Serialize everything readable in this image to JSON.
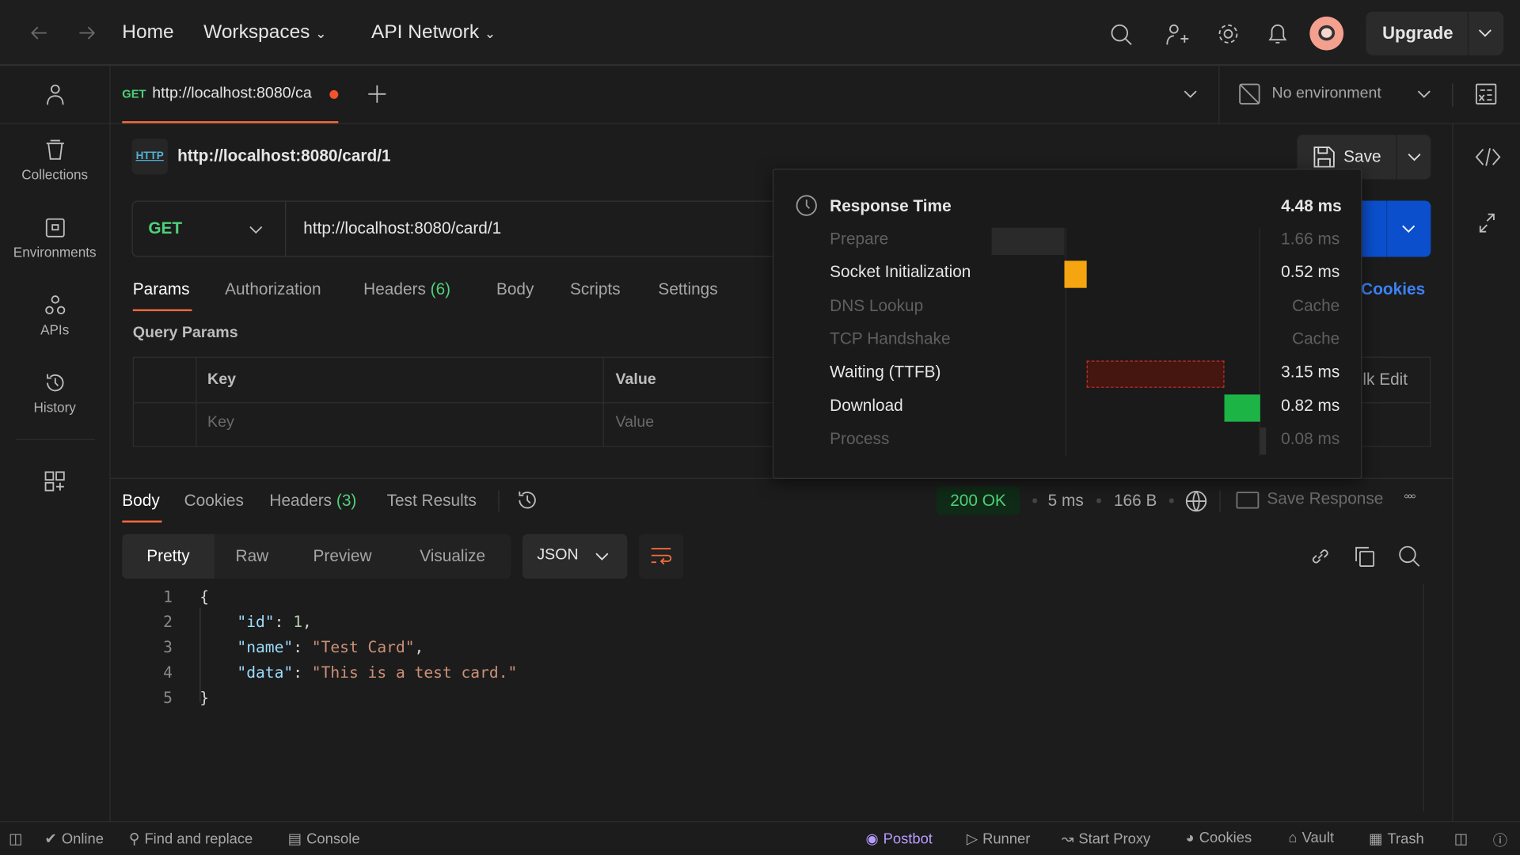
{
  "topbar": {
    "home": "Home",
    "workspaces": "Workspaces",
    "api_network": "API Network",
    "upgrade": "Upgrade"
  },
  "sidebar": {
    "items": [
      {
        "label": "Collections",
        "icon": "trash-can-icon"
      },
      {
        "label": "Environments",
        "icon": "environment-icon"
      },
      {
        "label": "APIs",
        "icon": "apis-icon"
      },
      {
        "label": "History",
        "icon": "history-icon"
      }
    ]
  },
  "tabbar": {
    "tab_method": "GET",
    "tab_url": "http://localhost:8080/ca",
    "environment": "No environment"
  },
  "request": {
    "title": "http://localhost:8080/card/1",
    "save": "Save",
    "method": "GET",
    "url": "http://localhost:8080/card/1",
    "cookies": "Cookies",
    "tabs": [
      {
        "label": "Params"
      },
      {
        "label": "Authorization"
      },
      {
        "label": "Headers",
        "count": "(6)"
      },
      {
        "label": "Body"
      },
      {
        "label": "Scripts"
      },
      {
        "label": "Settings"
      }
    ],
    "query_params": "Query Params",
    "col_key": "Key",
    "col_value": "Value",
    "key_placeholder": "Key",
    "value_placeholder": "Value",
    "bulk_edit": "Bulk Edit"
  },
  "response": {
    "tabs": [
      {
        "label": "Body"
      },
      {
        "label": "Cookies"
      },
      {
        "label": "Headers",
        "count": "(3)"
      },
      {
        "label": "Test Results"
      }
    ],
    "status": "200 OK",
    "time": "5 ms",
    "size": "166 B",
    "save_response": "Save Response",
    "views": [
      "Pretty",
      "Raw",
      "Preview",
      "Visualize"
    ],
    "format": "JSON",
    "lines": [
      [
        {
          "t": "{",
          "c": "p"
        }
      ],
      [
        {
          "t": "    \"id\"",
          "c": "k"
        },
        {
          "t": ": ",
          "c": "p"
        },
        {
          "t": "1",
          "c": "n"
        },
        {
          "t": ",",
          "c": "p"
        }
      ],
      [
        {
          "t": "    \"name\"",
          "c": "k"
        },
        {
          "t": ": ",
          "c": "p"
        },
        {
          "t": "\"Test Card\"",
          "c": "s"
        },
        {
          "t": ",",
          "c": "p"
        }
      ],
      [
        {
          "t": "    \"data\"",
          "c": "k"
        },
        {
          "t": ": ",
          "c": "p"
        },
        {
          "t": "\"This is a test card.\"",
          "c": "s"
        }
      ],
      [
        {
          "t": "}",
          "c": "p"
        }
      ]
    ]
  },
  "timing": {
    "title": "Response Time",
    "total": "4.48 ms",
    "phases": [
      {
        "label": "Prepare",
        "value": "1.66 ms",
        "ms": 1.66,
        "active": false,
        "color": "#2a2a2a"
      },
      {
        "label": "Socket Initialization",
        "value": "0.52 ms",
        "ms": 0.52,
        "active": true,
        "color": "#f5a50f"
      },
      {
        "label": "DNS Lookup",
        "value": "Cache",
        "ms": 0,
        "active": false
      },
      {
        "label": "TCP Handshake",
        "value": "Cache",
        "ms": 0,
        "active": false
      },
      {
        "label": "Waiting (TTFB)",
        "value": "3.15 ms",
        "ms": 3.15,
        "active": true,
        "color": "#45150f"
      },
      {
        "label": "Download",
        "value": "0.82 ms",
        "ms": 0.82,
        "active": true,
        "color": "#1db446"
      },
      {
        "label": "Process",
        "value": "0.08 ms",
        "ms": 0.08,
        "active": false,
        "color": "#2e2e2e"
      }
    ]
  },
  "statusbar": {
    "online": "Online",
    "find": "Find and replace",
    "console": "Console",
    "postbot": "Postbot",
    "runner": "Runner",
    "proxy": "Start Proxy",
    "cookies": "Cookies",
    "vault": "Vault",
    "trash": "Trash"
  },
  "colors": {
    "accent": "#f26b3a",
    "send": "#0b4fcc",
    "ok": "#4fd17a",
    "postbot": "#b89cff",
    "link": "#3b82f6"
  }
}
